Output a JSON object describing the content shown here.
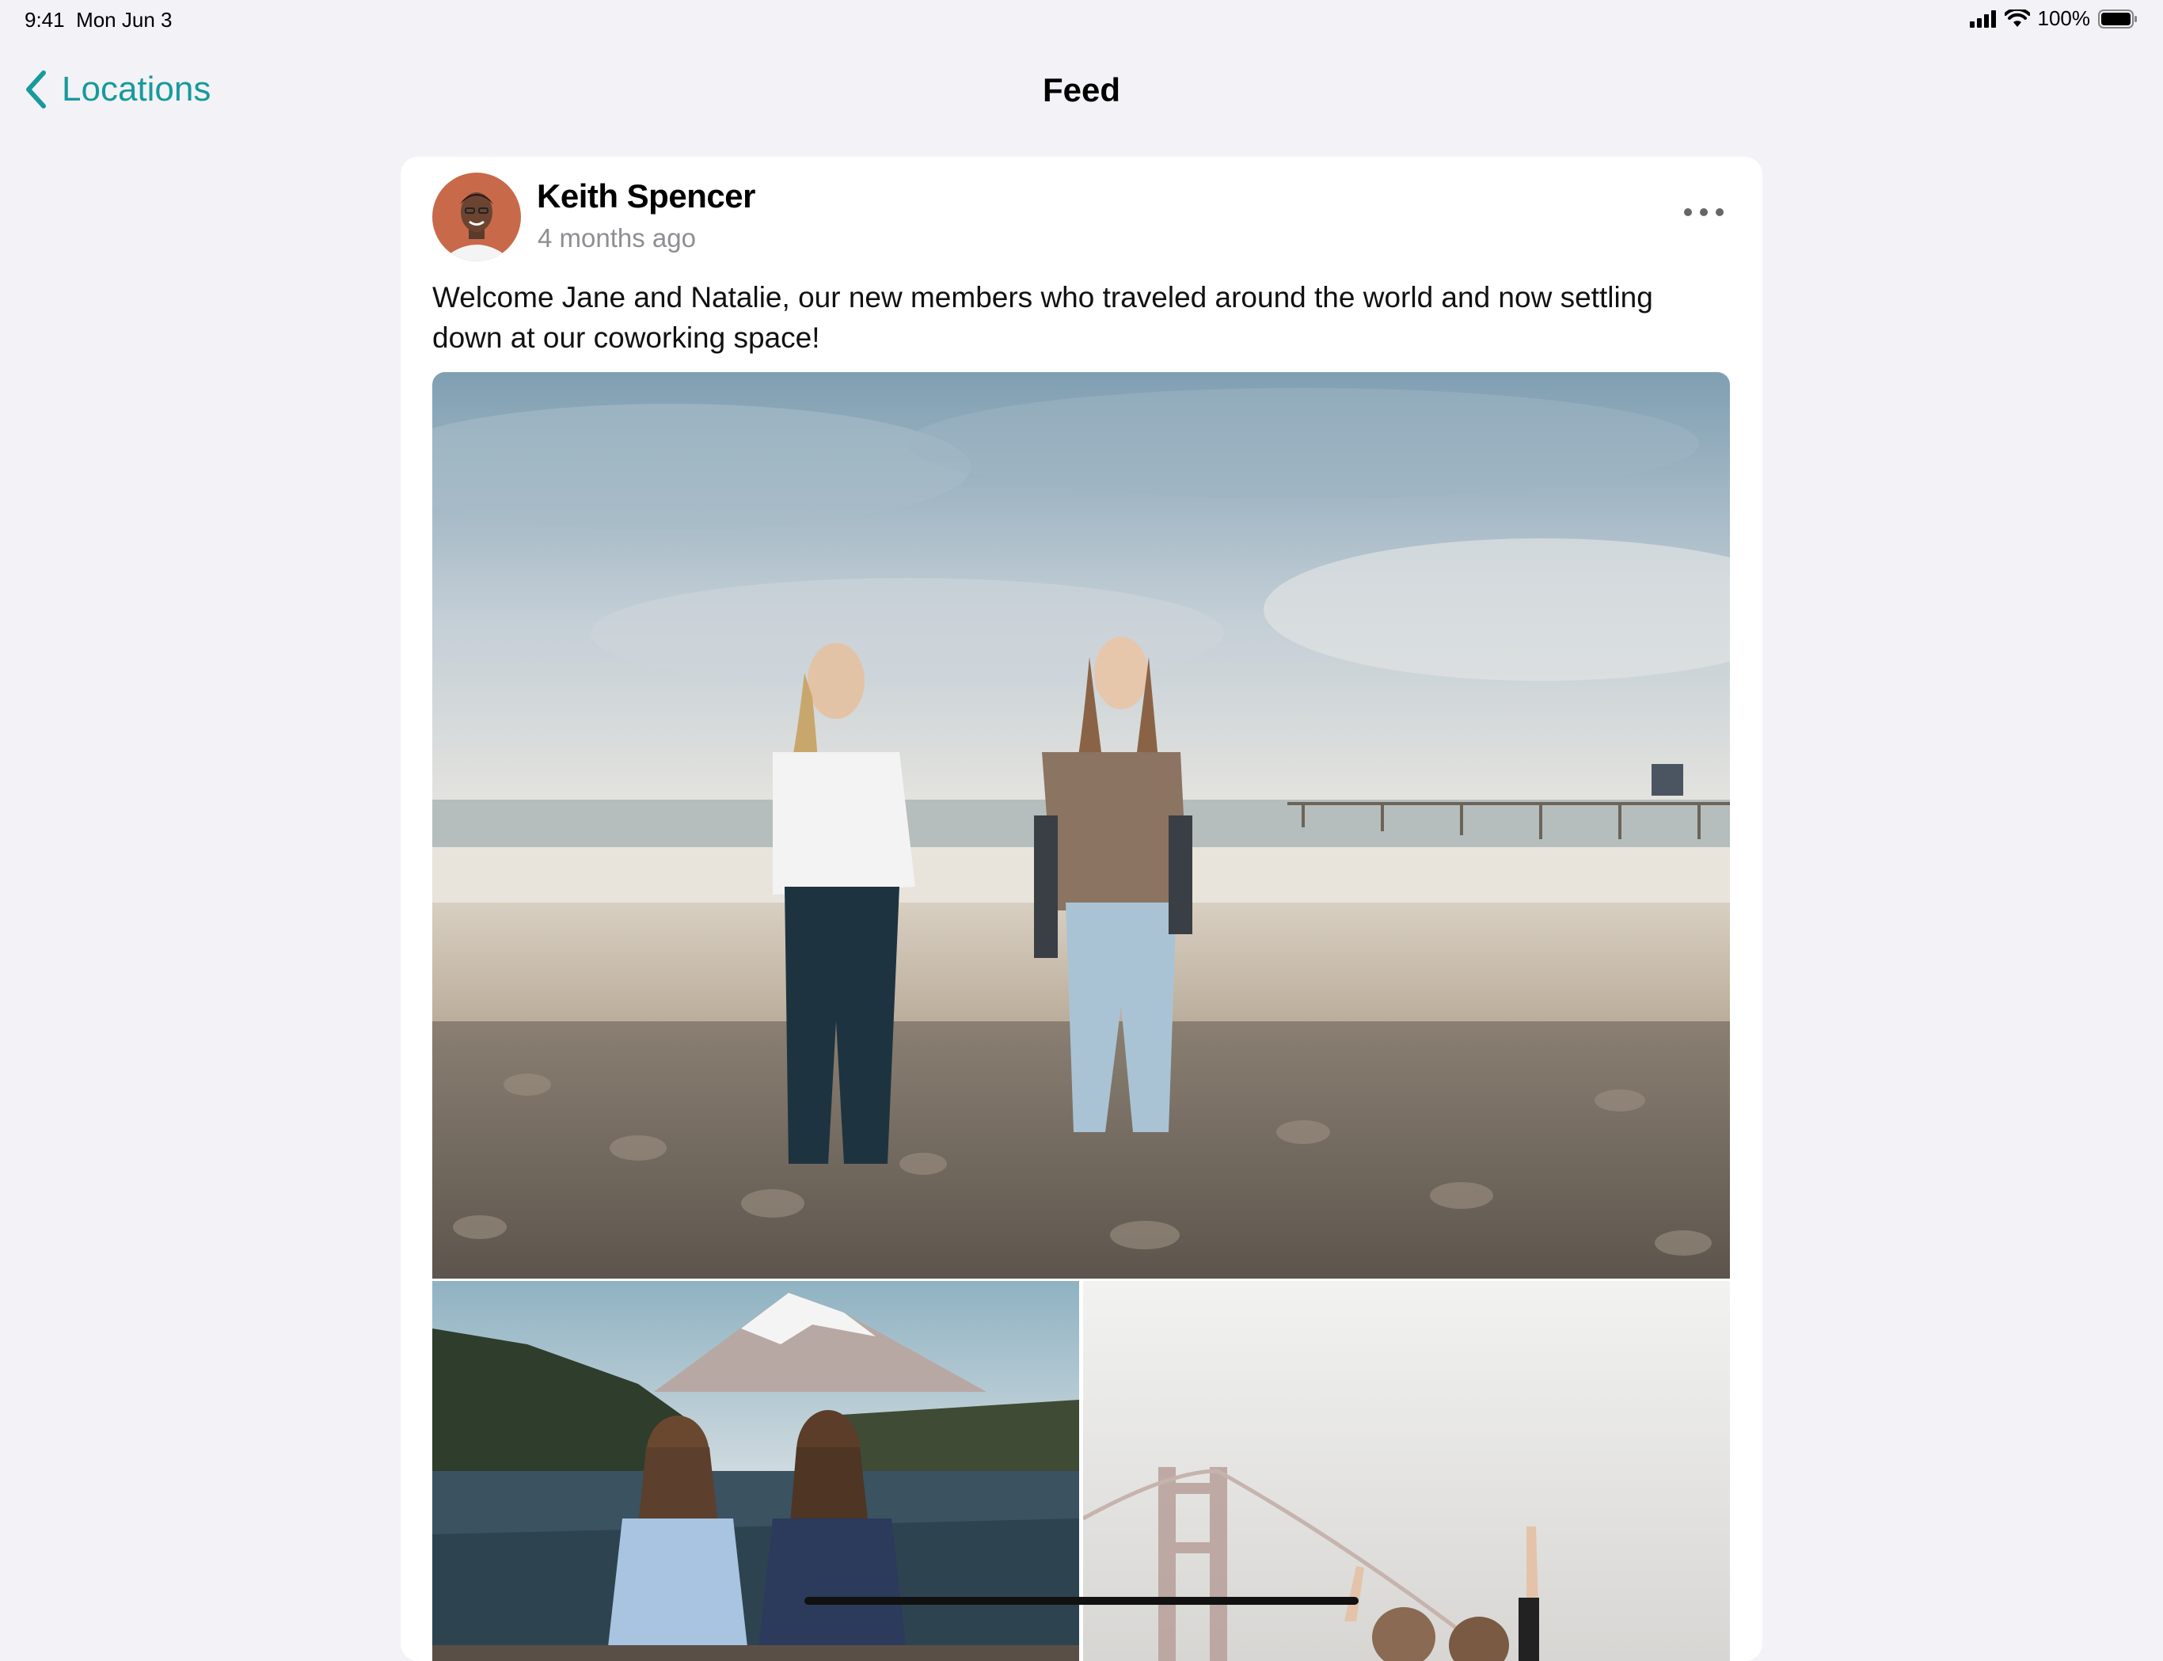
{
  "status_bar": {
    "time": "9:41",
    "date": "Mon Jun 3",
    "battery_percent": "100%",
    "battery_level": 1.0
  },
  "nav": {
    "back_label": "Locations",
    "title": "Feed"
  },
  "post": {
    "author": "Keith Spencer",
    "timestamp": "4 months ago",
    "text": "Welcome Jane and Natalie, our new members who traveled around the world and now settling down at our coworking space!",
    "photos": [
      {
        "id": "beach-photo",
        "description": "beach-photo"
      },
      {
        "id": "mountain-lake-photo",
        "description": "mountain-lake-photo"
      },
      {
        "id": "golden-gate-photo",
        "description": "golden-gate-photo"
      }
    ]
  },
  "colors": {
    "accent": "#179a9c",
    "background": "#f2f2f7",
    "secondary_text": "#8e8e93"
  },
  "icons": {
    "back": "chevron-left-icon",
    "more": "ellipsis-icon",
    "signal": "signal-icon",
    "wifi": "wifi-icon",
    "battery": "battery-icon"
  }
}
